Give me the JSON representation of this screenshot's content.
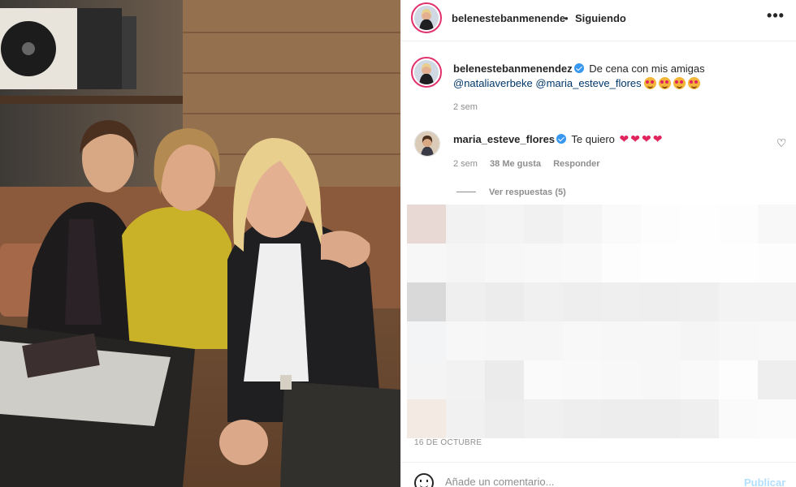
{
  "header": {
    "username": "belenestebanmenende",
    "separator": "•",
    "follow_status": "Siguiendo",
    "more_icon": "more-horizontal-icon"
  },
  "caption": {
    "username": "belenestebanmenendez",
    "text": "De cena con mis amigas",
    "mention_1": "@nataliaverbeke",
    "mention_2": "@maria_esteve_flores",
    "emoji_icon": "smiling-face-with-hearts-icon",
    "emoji_count": 4,
    "time": "2 sem"
  },
  "comment": {
    "username": "maria_esteve_flores",
    "text": "Te quiero",
    "heart_icon": "red-heart-icon",
    "heart_count": 4,
    "time": "2 sem",
    "likes": "38 Me gusta",
    "reply": "Responder",
    "view_replies": "Ver respuestas (5)"
  },
  "post_date_fragment": "16 DE OCTUBRE",
  "add_comment": {
    "placeholder": "Añade un comentario...",
    "publish": "Publicar"
  },
  "colors": {
    "link": "#00376b",
    "verified": "#3897f0",
    "publish_disabled": "#b2dffc",
    "muted": "#8e8e8e"
  }
}
